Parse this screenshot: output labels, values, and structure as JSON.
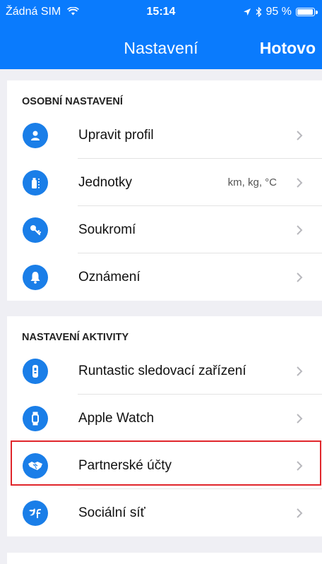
{
  "status_bar": {
    "carrier": "Žádná SIM",
    "time": "15:14",
    "battery": "95 %"
  },
  "navbar": {
    "title": "Nastavení",
    "done": "Hotovo"
  },
  "sections": [
    {
      "header": "OSOBNÍ NASTAVENÍ",
      "items": [
        {
          "label": "Upravit profil",
          "icon": "person-icon"
        },
        {
          "label": "Jednotky",
          "detail": "km, kg, °C",
          "icon": "units-icon"
        },
        {
          "label": "Soukromí",
          "icon": "key-icon"
        },
        {
          "label": "Oznámení",
          "icon": "bell-icon"
        }
      ]
    },
    {
      "header": "NASTAVENÍ AKTIVITY",
      "items": [
        {
          "label": "Runtastic sledovací zařízení",
          "icon": "tracker-icon"
        },
        {
          "label": "Apple Watch",
          "icon": "watch-icon"
        },
        {
          "label": "Partnerské účty",
          "icon": "handshake-icon"
        },
        {
          "label": "Sociální síť",
          "icon": "social-icon"
        }
      ]
    }
  ],
  "colors": {
    "accent": "#0a7bfd",
    "icon_bg": "#1a7ee8",
    "highlight": "#e0262b",
    "background": "#efeff4"
  }
}
